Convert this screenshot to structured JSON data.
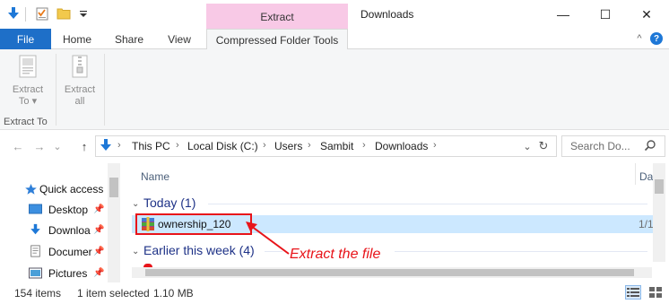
{
  "window": {
    "title": "Downloads",
    "contextual_group": "Extract",
    "minimize_glyph": "—",
    "maximize_glyph": "☐",
    "close_glyph": "✕"
  },
  "quick_access_icons": [
    "down-arrow-icon",
    "checklist-icon",
    "folder-icon",
    "customize-toolbar-icon"
  ],
  "ribbon": {
    "tabs": [
      {
        "label": "File"
      },
      {
        "label": "Home"
      },
      {
        "label": "Share"
      },
      {
        "label": "View"
      },
      {
        "label": "Compressed Folder Tools"
      }
    ],
    "buttons": [
      {
        "label": "Extract To ▾",
        "line1": "Extract",
        "line2": "To ▾"
      },
      {
        "label": "Extract all",
        "line1": "Extract",
        "line2": "all"
      }
    ],
    "group_label": "Extract To",
    "collapse_glyph": "^",
    "help_glyph": "?"
  },
  "address": {
    "back_glyph": "←",
    "forward_glyph": "→",
    "recent_glyph": "⌄",
    "up_glyph": "↑",
    "breadcrumb": [
      "This PC",
      "Local Disk (C:)",
      "Users",
      "Sambit",
      "Downloads"
    ],
    "crumb_sep": "›",
    "dropdown_glyph": "⌄",
    "refresh_glyph": "↻",
    "search_placeholder": "Search Do..."
  },
  "nav_pane": {
    "items": [
      {
        "label": "Quick access",
        "icon": "star-icon"
      },
      {
        "label": "Desktop",
        "icon": "desktop-icon"
      },
      {
        "label": "Downloa",
        "icon": "download-icon"
      },
      {
        "label": "Documer",
        "icon": "documents-icon"
      },
      {
        "label": "Pictures",
        "icon": "pictures-icon"
      }
    ],
    "pin_glyph": "📌"
  },
  "file_list": {
    "columns": [
      "Name",
      "Da"
    ],
    "groups": [
      {
        "label": "Today (1)"
      },
      {
        "label": "Earlier this week (4)"
      }
    ],
    "selected_file": {
      "name": "ownership_120",
      "date": "1/1"
    },
    "annotation": "Extract the file"
  },
  "status_bar": {
    "item_count": "154 items",
    "selection": "1 item selected",
    "size": "1.10 MB"
  },
  "colors": {
    "file_tab": "#1e6fc8",
    "contextual_band": "#f8c9e6",
    "selection": "#cce8ff",
    "annotation": "#e8141a",
    "group_header": "#1e3287"
  }
}
